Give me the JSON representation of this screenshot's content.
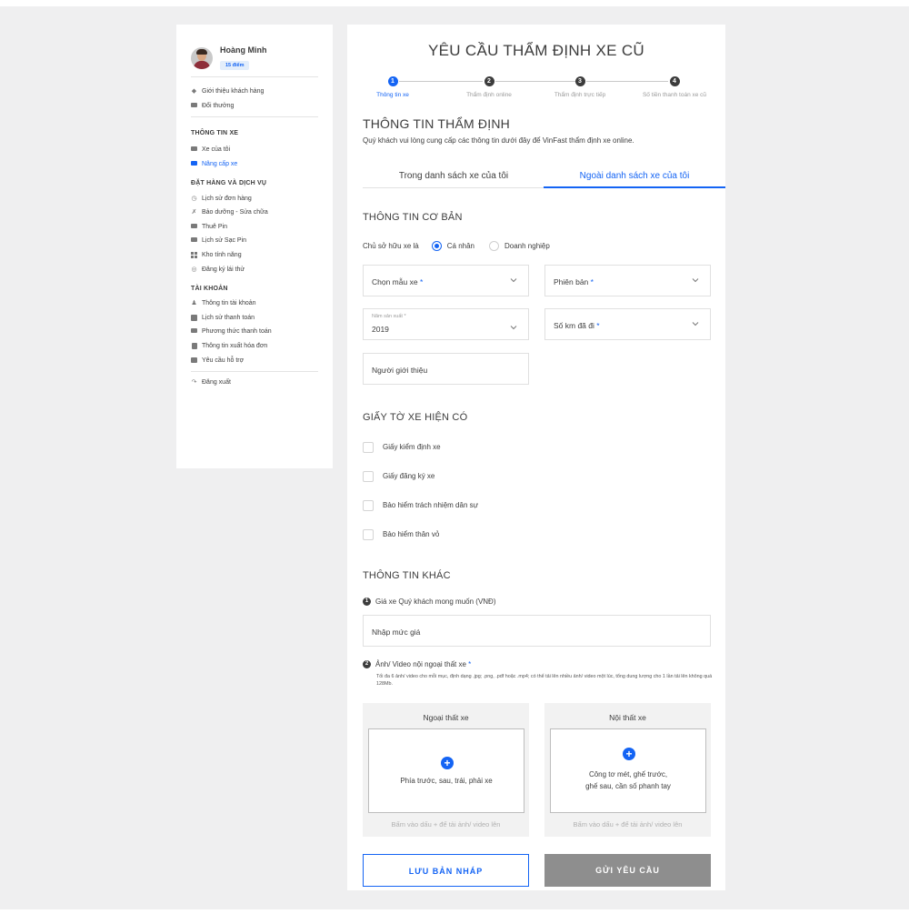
{
  "profile": {
    "name": "Hoàng Minh",
    "points": "15 điểm"
  },
  "sidebar": {
    "top_items": [
      {
        "label": "Giới thiệu khách hàng",
        "icon": "tag-icon"
      },
      {
        "label": "Đổi thưởng",
        "icon": "gift-icon"
      }
    ],
    "vehicle_title": "THÔNG TIN XE",
    "vehicle_items": [
      {
        "label": "Xe của tôi",
        "icon": "car-icon"
      },
      {
        "label": "Nâng cấp xe",
        "icon": "car-upgrade-icon",
        "active": true
      }
    ],
    "order_title": "ĐẶT HÀNG VÀ DỊCH VỤ",
    "order_items": [
      {
        "label": "Lịch sử đơn hàng",
        "icon": "history-icon"
      },
      {
        "label": "Bảo dưỡng - Sửa chữa",
        "icon": "tools-icon"
      },
      {
        "label": "Thuê Pin",
        "icon": "battery-icon"
      },
      {
        "label": "Lịch sử Sạc Pin",
        "icon": "charging-icon"
      },
      {
        "label": "Kho tính năng",
        "icon": "grid-icon"
      },
      {
        "label": "Đăng ký lái thử",
        "icon": "steering-wheel-icon"
      }
    ],
    "account_title": "TÀI KHOẢN",
    "account_items": [
      {
        "label": "Thông tin tài khoản",
        "icon": "user-icon"
      },
      {
        "label": "Lịch sử thanh toán",
        "icon": "receipt-icon"
      },
      {
        "label": "Phương thức thanh toán",
        "icon": "card-icon"
      },
      {
        "label": "Thông tin xuất hóa đơn",
        "icon": "invoice-icon"
      },
      {
        "label": "Yêu cầu hỗ trợ",
        "icon": "support-icon"
      }
    ],
    "logout": "Đăng xuất"
  },
  "main": {
    "title": "YÊU CẦU THẨM ĐỊNH XE CŨ",
    "steps": [
      {
        "num": "1",
        "label": "Thông tin xe",
        "active": true
      },
      {
        "num": "2",
        "label": "Thẩm định online"
      },
      {
        "num": "3",
        "label": "Thẩm định trực tiếp"
      },
      {
        "num": "4",
        "label": "Số tiền thanh toán xe cũ"
      }
    ],
    "section_title": "THÔNG TIN THẨM ĐỊNH",
    "subtitle": "Quý khách vui lòng cung cấp các thông tin dưới đây để VinFast thẩm định xe online.",
    "tabs": [
      "Trong danh sách xe của tôi",
      "Ngoài danh sách xe của tôi"
    ],
    "active_tab": 1,
    "basic_title": "THÔNG TIN CƠ BẢN",
    "owner_label": "Chủ sở hữu xe là",
    "owner_options": [
      "Cá nhân",
      "Doanh nghiệp"
    ],
    "owner_selected": "Cá nhân",
    "model_placeholder": "Chọn mẫu xe",
    "version_placeholder": "Phiên bản",
    "year_label": "Năm sản xuất *",
    "year_value": "2019",
    "km_placeholder": "Số km đã đi",
    "referrer_placeholder": "Người giới thiệu",
    "docs_title": "GIẤY TỜ XE HIỆN CÓ",
    "docs": [
      "Giấy kiểm định xe",
      "Giấy đăng ký xe",
      "Bảo hiểm trách nhiệm dân sự",
      "Bảo hiểm thân vỏ"
    ],
    "other_title": "THÔNG TIN KHÁC",
    "q1_num": "1",
    "q1_label": "Giá xe Quý khách mong muốn (VNĐ)",
    "price_placeholder": "Nhập mức giá",
    "q2_num": "2",
    "q2_label": "Ảnh/ Video nội ngoại thất xe",
    "required_mark": "*",
    "q2_hint": "Tối đa 6 ảnh/ video cho mỗi mục, định dạng .jpg; .png, .pdf hoặc .mp4; có thể tải lên nhiều ảnh/ video một lúc, tổng dung lượng cho 1 lần tải lên không quá 128Mb.",
    "exterior": {
      "title": "Ngoại thất xe",
      "label": "Phía trước, sau, trái, phải xe",
      "hint": "Bấm vào dấu + để tải ảnh/ video lên"
    },
    "interior": {
      "title": "Nội thất xe",
      "label1": "Công tơ mét, ghế trước,",
      "label2": "ghế sau, cần số phanh tay",
      "hint": "Bấm vào dấu + để tải ảnh/ video lên"
    },
    "save_draft": "LƯU BẢN NHÁP",
    "submit": "GỬI YÊU CẦU"
  },
  "colors": {
    "accent": "#1464f4",
    "disabled_button": "#8e8e8e",
    "page_bg": "#efeff0"
  }
}
